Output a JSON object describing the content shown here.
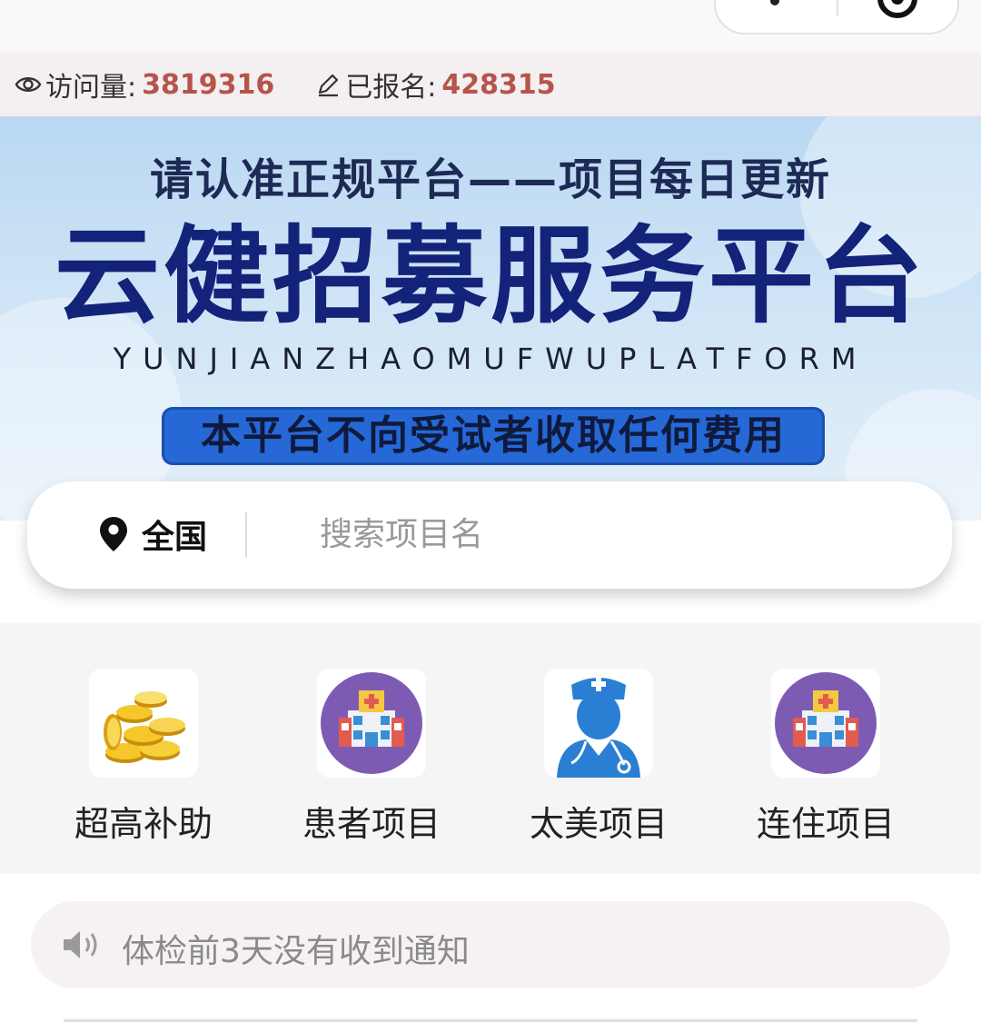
{
  "stats": {
    "visits_label": "访问量:",
    "visits_value": "3819316",
    "signed_label": "已报名:",
    "signed_value": "428315",
    "visits_icon": "eye-icon",
    "signed_icon": "pencil-icon"
  },
  "banner": {
    "subtitle": "请认准正规平台——项目每日更新",
    "title": "云健招募服务平台",
    "pinyin": "YUNJIANZHAOMUFWUPLATFORM",
    "notice": "本平台不向受试者收取任何费用"
  },
  "search": {
    "region": "全国",
    "region_icon": "location-pin-icon",
    "placeholder": "搜索项目名"
  },
  "categories": [
    {
      "label": "超高补助",
      "icon": "gold-coins-icon"
    },
    {
      "label": "患者项目",
      "icon": "hospital-icon"
    },
    {
      "label": "太美项目",
      "icon": "doctor-icon"
    },
    {
      "label": "连住项目",
      "icon": "hospital-icon"
    }
  ],
  "notice": {
    "text": "体检前3天没有收到通知",
    "icon": "speaker-icon"
  },
  "colors": {
    "accent_value": "#b5544b",
    "banner_title": "#13237a",
    "banner_pill": "#2568d6"
  }
}
